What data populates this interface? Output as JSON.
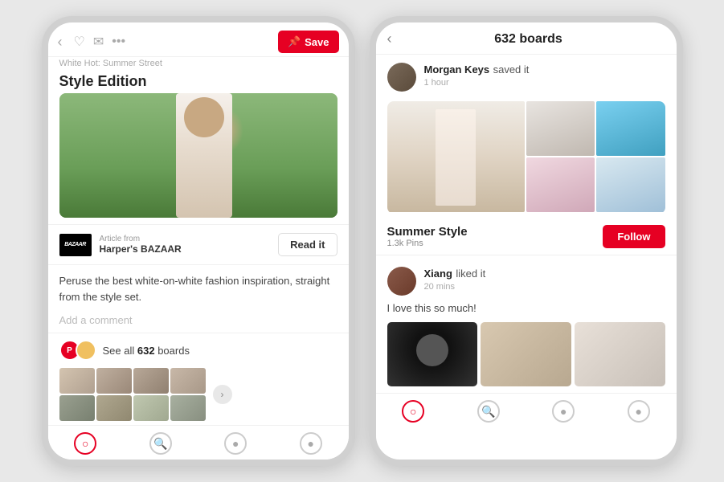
{
  "phone1": {
    "header": {
      "subtitle": "White Hot: Summer Street",
      "title": "Style Edition",
      "save_label": "Save"
    },
    "article": {
      "from_label": "Article from",
      "source": "Harper's BAZAAR",
      "read_label": "Read it"
    },
    "description": "Peruse the best white-on-white fashion inspiration, straight from the style set.",
    "comment_placeholder": "Add a comment",
    "boards": {
      "see_all": "See all",
      "count": "632",
      "label": "boards"
    },
    "nav": {
      "items": [
        "pinterest",
        "search",
        "chat",
        "profile"
      ]
    }
  },
  "phone2": {
    "header": {
      "title": "632 boards"
    },
    "activity1": {
      "name": "Morgan Keys",
      "action": "saved it",
      "time": "1 hour"
    },
    "board": {
      "name": "Summer Style",
      "pin_count": "1.3k Pins",
      "follow_label": "Follow"
    },
    "activity2": {
      "name": "Xiang",
      "action": "liked it",
      "time": "20 mins",
      "comment": "I love this so much!"
    },
    "nav": {
      "items": [
        "pinterest",
        "search",
        "chat",
        "profile"
      ]
    }
  }
}
